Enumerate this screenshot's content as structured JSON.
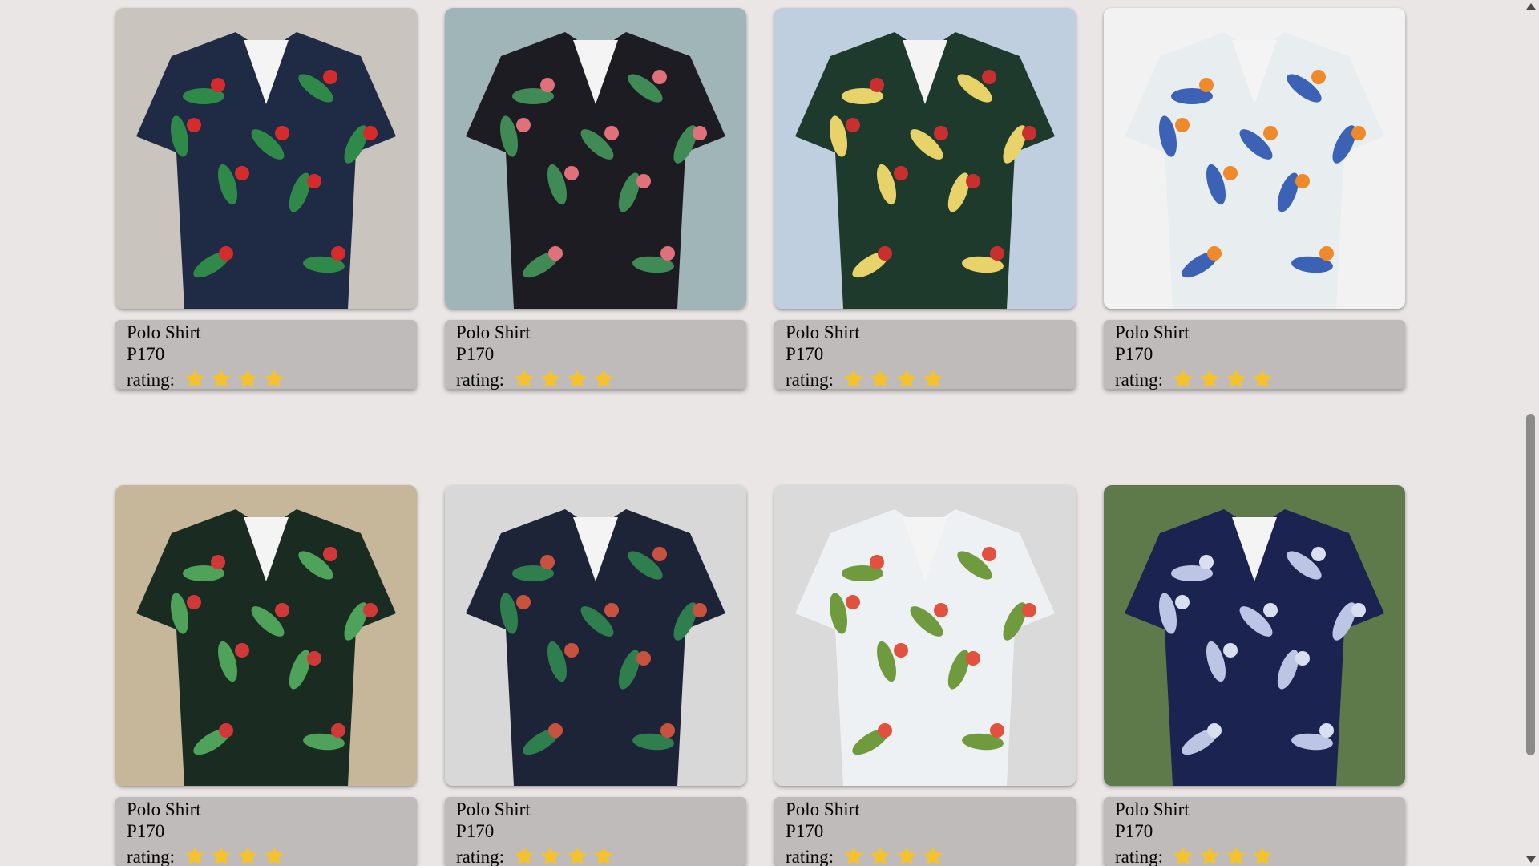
{
  "products": [
    {
      "name": "Polo Shirt",
      "price": "P170",
      "rating_label": "rating:",
      "rating": 4,
      "bg": "#c9c4bd",
      "shirt": "#1f2a44",
      "accent": "#d62b2b",
      "leaf": "#2f8a4a"
    },
    {
      "name": "Polo Shirt",
      "price": "P170",
      "rating_label": "rating:",
      "rating": 4,
      "bg": "#9fb5b8",
      "shirt": "#1c1c22",
      "accent": "#e0707a",
      "leaf": "#3f8a55"
    },
    {
      "name": "Polo Shirt",
      "price": "P170",
      "rating_label": "rating:",
      "rating": 4,
      "bg": "#bfcfe0",
      "shirt": "#1d3a2c",
      "accent": "#c92f2f",
      "leaf": "#e8d36a"
    },
    {
      "name": "Polo Shirt",
      "price": "P170",
      "rating_label": "rating:",
      "rating": 4,
      "bg": "#f2f2f2",
      "shirt": "#e8eef0",
      "accent": "#ee8a2a",
      "leaf": "#3c62b6"
    },
    {
      "name": "Polo Shirt",
      "price": "P170",
      "rating_label": "rating:",
      "rating": 4,
      "bg": "#c7b79a",
      "shirt": "#1a2b22",
      "accent": "#d23838",
      "leaf": "#4ea25a"
    },
    {
      "name": "Polo Shirt",
      "price": "P170",
      "rating_label": "rating:",
      "rating": 4,
      "bg": "#d8d8d8",
      "shirt": "#1e2437",
      "accent": "#c9523e",
      "leaf": "#2e7e4e"
    },
    {
      "name": "Polo Shirt",
      "price": "P170",
      "rating_label": "rating:",
      "rating": 4,
      "bg": "#dadada",
      "shirt": "#eef1f4",
      "accent": "#e1513e",
      "leaf": "#6f9a3d"
    },
    {
      "name": "Polo Shirt",
      "price": "P170",
      "rating_label": "rating:",
      "rating": 4,
      "bg": "#5f7a4a",
      "shirt": "#1b2350",
      "accent": "#d9dff0",
      "leaf": "#bcc6e4"
    }
  ],
  "colors": {
    "page_bg": "#ebe6e6",
    "card_info_bg": "#bfbbba",
    "star": "#f6c22b"
  }
}
